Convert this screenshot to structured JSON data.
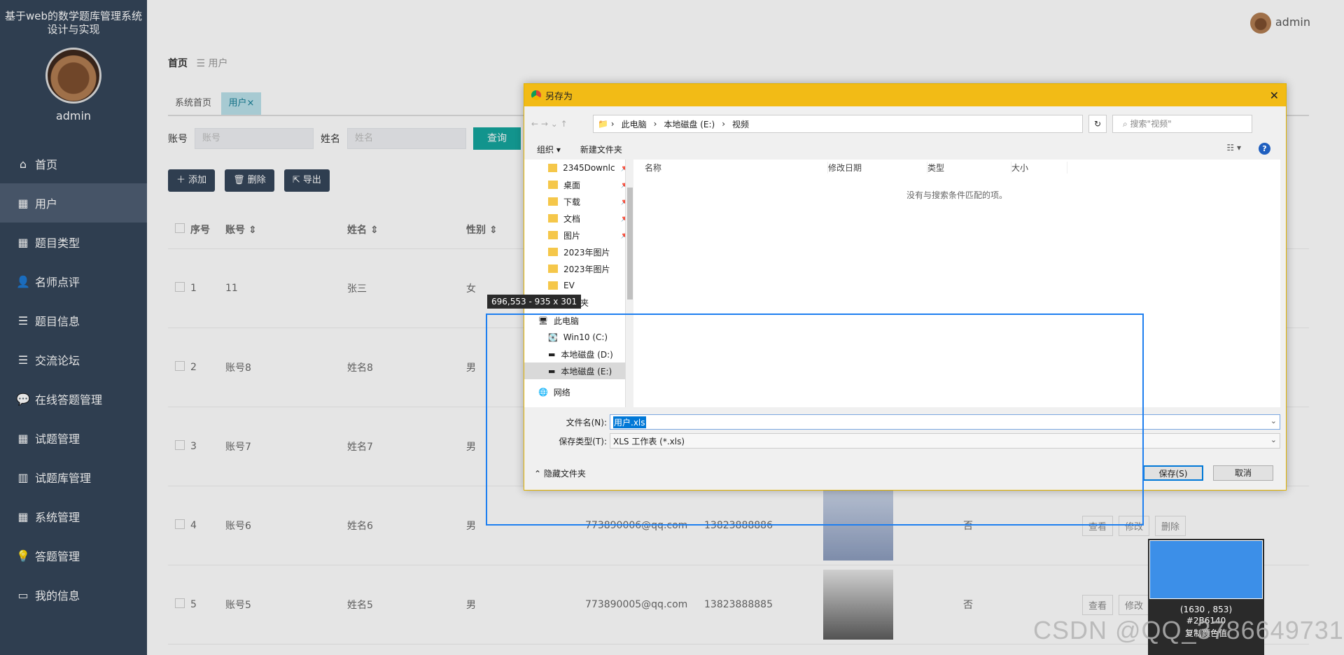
{
  "sidebar": {
    "title": "基于web的数学题库管理系统设计与实现",
    "username": "admin",
    "items": [
      {
        "label": "首页",
        "icon": "home-icon"
      },
      {
        "label": "用户",
        "icon": "grid-icon"
      },
      {
        "label": "题目类型",
        "icon": "grid-icon"
      },
      {
        "label": "名师点评",
        "icon": "person-icon"
      },
      {
        "label": "题目信息",
        "icon": "list-icon"
      },
      {
        "label": "交流论坛",
        "icon": "list-icon"
      },
      {
        "label": "在线答题管理",
        "icon": "chat-icon"
      },
      {
        "label": "试题管理",
        "icon": "grid-icon"
      },
      {
        "label": "试题库管理",
        "icon": "bar-chart-icon"
      },
      {
        "label": "系统管理",
        "icon": "grid-icon"
      },
      {
        "label": "答题管理",
        "icon": "bulb-icon"
      },
      {
        "label": "我的信息",
        "icon": "card-icon"
      }
    ]
  },
  "topbar": {
    "username": "admin"
  },
  "breadcrumb": {
    "home": "首页",
    "sep": "☰",
    "current": "用户"
  },
  "tabs": [
    {
      "label": "系统首页"
    },
    {
      "label": "用户",
      "close": "×"
    }
  ],
  "filter": {
    "account_label": "账号",
    "account_placeholder": "账号",
    "name_label": "姓名",
    "name_placeholder": "姓名",
    "query_label": "查询"
  },
  "actions": {
    "add": "添加",
    "delete": "删除",
    "export": "导出"
  },
  "table": {
    "headers": [
      "序号",
      "账号",
      "姓名",
      "性别"
    ],
    "rows": [
      {
        "no": "1",
        "account": "11",
        "name": "张三",
        "gender": "女",
        "email": "",
        "phone": "",
        "flag": ""
      },
      {
        "no": "2",
        "account": "账号8",
        "name": "姓名8",
        "gender": "男",
        "email": "",
        "phone": "",
        "flag": ""
      },
      {
        "no": "3",
        "account": "账号7",
        "name": "姓名7",
        "gender": "男",
        "email": "",
        "phone": "",
        "flag": ""
      },
      {
        "no": "4",
        "account": "账号6",
        "name": "姓名6",
        "gender": "男",
        "email": "773890006@qq.com",
        "phone": "13823888886",
        "flag": "否"
      },
      {
        "no": "5",
        "account": "账号5",
        "name": "姓名5",
        "gender": "男",
        "email": "773890005@qq.com",
        "phone": "13823888885",
        "flag": "否"
      }
    ],
    "row_actions": {
      "view": "查看",
      "edit": "修改",
      "delete": "删除"
    }
  },
  "dialog": {
    "title": "另存为",
    "close": "✕",
    "path": [
      "此电脑",
      "本地磁盘 (E:)",
      "视频"
    ],
    "search_placeholder": "搜索\"视频\"",
    "organize": "组织 ▾",
    "new_folder": "新建文件夹",
    "help": "?",
    "nav_items": [
      {
        "label": "2345Downlc",
        "pinned": true
      },
      {
        "label": "桌面",
        "pinned": true
      },
      {
        "label": "下载",
        "pinned": true
      },
      {
        "label": "文档",
        "pinned": true
      },
      {
        "label": "图片",
        "pinned": true
      },
      {
        "label": "2023年图片",
        "pinned": false
      },
      {
        "label": "2023年图片",
        "pinned": false
      },
      {
        "label": "EV",
        "pinned": false
      },
      {
        "label": "文件夹",
        "pinned": false
      },
      {
        "label": "此电脑",
        "pinned": false
      },
      {
        "label": "Win10 (C:)",
        "pinned": false
      },
      {
        "label": "本地磁盘 (D:)",
        "pinned": false
      },
      {
        "label": "本地磁盘 (E:)",
        "pinned": false
      },
      {
        "label": "网络",
        "pinned": false
      }
    ],
    "columns": [
      "名称",
      "修改日期",
      "类型",
      "大小"
    ],
    "empty_text": "没有与搜索条件匹配的项。",
    "filename_label": "文件名(N):",
    "filename_value": "用户.xls",
    "filetype_label": "保存类型(T):",
    "filetype_value": "XLS 工作表 (*.xls)",
    "hide_folders": "隐藏文件夹",
    "save": "保存(S)",
    "cancel": "取消"
  },
  "capture": {
    "tooltip": "696,553 - 935 x 301",
    "coords": "(1630 , 853)",
    "color_hex": "#2B6140",
    "copy_hint": "复制颜色值"
  },
  "watermark": "CSDN @QQ_3786649731",
  "colors": {
    "sidebar": "#304156",
    "accent": "#0fa39b",
    "dialog_title": "#f2bb16",
    "capture_border": "#1e7ff0"
  }
}
